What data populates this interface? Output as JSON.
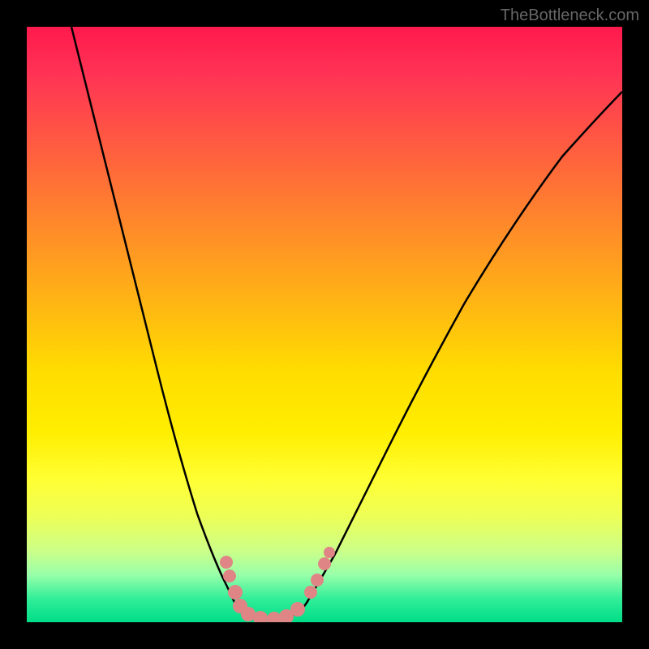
{
  "watermark_text": "TheBottleneck.com",
  "chart_data": {
    "type": "line",
    "title": "",
    "xlabel": "",
    "ylabel": "",
    "description": "V-shaped bottleneck curve over rainbow gradient background. The curve represents bottleneck percentage - high at edges (red zone), minimum near x=0.35 (green zone).",
    "x": [
      0.0,
      0.05,
      0.1,
      0.15,
      0.2,
      0.25,
      0.28,
      0.3,
      0.32,
      0.34,
      0.36,
      0.38,
      0.4,
      0.42,
      0.45,
      0.5,
      0.55,
      0.6,
      0.65,
      0.7,
      0.75,
      0.8,
      0.85,
      0.9,
      0.95,
      1.0
    ],
    "y": [
      1.0,
      0.88,
      0.76,
      0.62,
      0.48,
      0.32,
      0.22,
      0.14,
      0.08,
      0.04,
      0.02,
      0.02,
      0.02,
      0.04,
      0.08,
      0.16,
      0.25,
      0.34,
      0.42,
      0.5,
      0.57,
      0.63,
      0.68,
      0.73,
      0.77,
      0.8
    ],
    "ylim": [
      0,
      1
    ],
    "xlim": [
      0,
      1
    ],
    "gradient_colors": [
      "#ff1a4d",
      "#ff7733",
      "#ffdd00",
      "#ffff33",
      "#33ee99"
    ],
    "marker_color": "#e88080",
    "line_color": "#000000"
  }
}
